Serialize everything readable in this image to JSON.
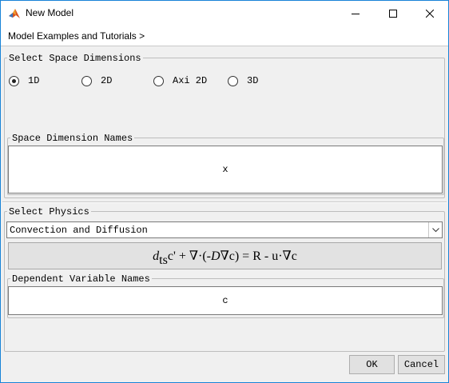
{
  "window": {
    "title": "New Model",
    "app_icon": "matlab-icon",
    "controls": [
      "minimize-icon",
      "maximize-icon",
      "close-icon"
    ]
  },
  "breadcrumb": "Model Examples and Tutorials >",
  "space_dimensions": {
    "group_label": "Select Space Dimensions",
    "options": [
      "1D",
      "2D",
      "Axi 2D",
      "3D"
    ],
    "selected": "1D"
  },
  "space_dimension_names": {
    "group_label": "Space Dimension Names",
    "value": "x"
  },
  "physics": {
    "group_label": "Select Physics",
    "selected": "Convection and Diffusion",
    "equation": {
      "d": "d",
      "ts": "ts",
      "rest": "c' + ∇·(-",
      "D": "D",
      "tail": "∇c) = R - u·∇c"
    }
  },
  "dependent_variable_names": {
    "group_label": "Dependent Variable Names",
    "value": "c"
  },
  "buttons": {
    "ok": "OK",
    "cancel": "Cancel"
  },
  "colors": {
    "window_border": "#1883d7",
    "background": "#f0f0f0",
    "equation_box": "#e2e2e2"
  }
}
